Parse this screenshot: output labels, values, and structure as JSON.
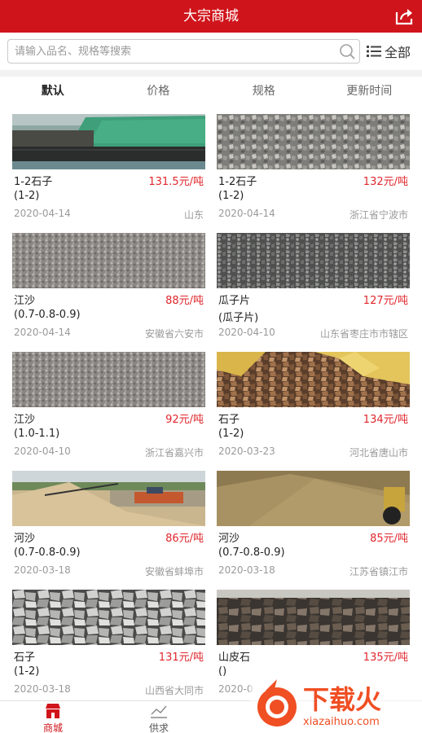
{
  "header": {
    "title": "大宗商城",
    "share_icon": "share-icon"
  },
  "search": {
    "placeholder": "请输入品名、规格等搜索",
    "all_label": "全部"
  },
  "sort_tabs": [
    {
      "label": "默认"
    },
    {
      "label": "价格"
    },
    {
      "label": "规格"
    },
    {
      "label": "更新时间"
    }
  ],
  "products": [
    {
      "name": "1-2石子",
      "price": "131.5元/吨",
      "spec": "(1-2)",
      "date": "2020-04-14",
      "location": "山东"
    },
    {
      "name": "1-2石子",
      "price": "132元/吨",
      "spec": "(1-2)",
      "date": "2020-04-14",
      "location": "浙江省宁波市"
    },
    {
      "name": "江沙",
      "price": "88元/吨",
      "spec": "(0.7-0.8-0.9)",
      "date": "2020-04-14",
      "location": "安徽省六安市"
    },
    {
      "name": "瓜子片",
      "price": "127元/吨",
      "spec": "(瓜子片)",
      "date": "2020-04-10",
      "location": "山东省枣庄市市辖区"
    },
    {
      "name": "江沙",
      "price": "92元/吨",
      "spec": "(1.0-1.1)",
      "date": "2020-04-10",
      "location": "浙江省嘉兴市"
    },
    {
      "name": "石子",
      "price": "134元/吨",
      "spec": "(1-2)",
      "date": "2020-03-23",
      "location": "河北省唐山市"
    },
    {
      "name": "河沙",
      "price": "86元/吨",
      "spec": "(0.7-0.8-0.9)",
      "date": "2020-03-18",
      "location": "安徽省蚌埠市"
    },
    {
      "name": "河沙",
      "price": "85元/吨",
      "spec": "(0.7-0.8-0.9)",
      "date": "2020-03-18",
      "location": "江苏省镇江市"
    },
    {
      "name": "石子",
      "price": "131元/吨",
      "spec": "(1-2)",
      "date": "2020-03-18",
      "location": "山西省大同市"
    },
    {
      "name": "山皮石",
      "price": "135元/吨",
      "spec": "()",
      "date": "2020-0",
      "location": ""
    }
  ],
  "bottom_nav": [
    {
      "label": "商城",
      "icon": "shop-icon"
    },
    {
      "label": "供求",
      "icon": "supply-demand-icon"
    }
  ],
  "watermark": {
    "text_cn": "下载火",
    "text_en": "xiazaihuo.com"
  },
  "colors": {
    "brand_red": "#d0141b",
    "price_red": "#e0262c"
  }
}
